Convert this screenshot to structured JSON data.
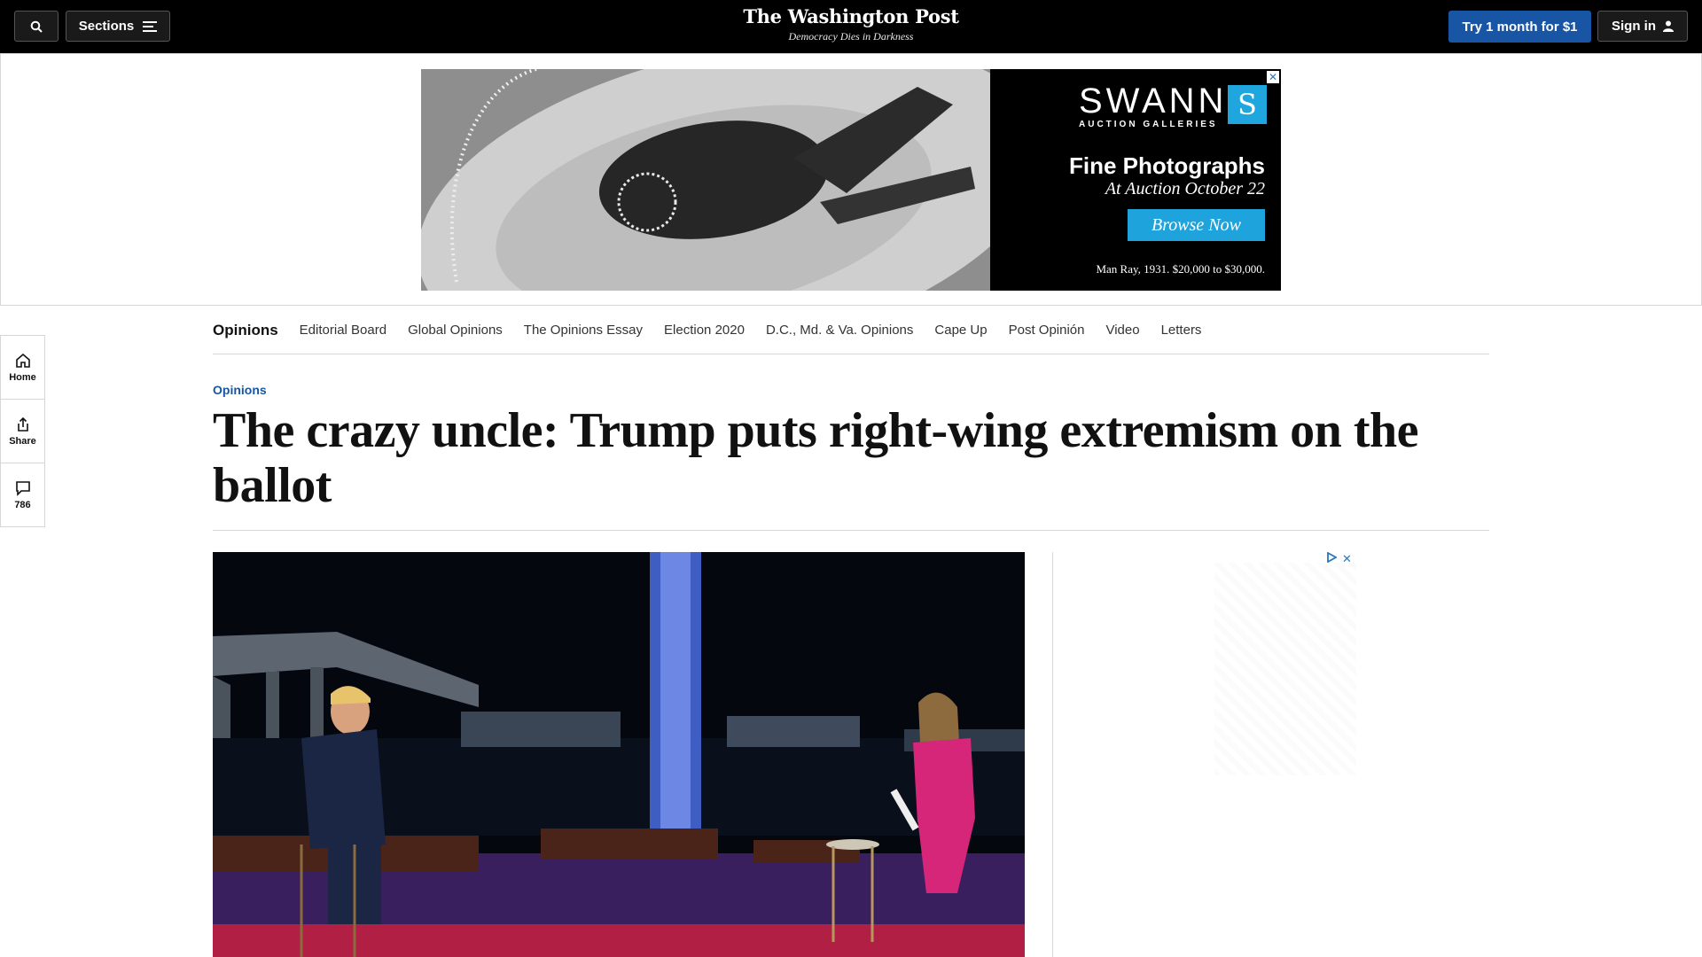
{
  "topbar": {
    "sections_label": "Sections",
    "brand": "The Washington Post",
    "tagline": "Democracy Dies in Darkness",
    "subscribe_label": "Try 1 month for $1",
    "signin_label": "Sign in"
  },
  "ad_banner": {
    "brand": "SWANN",
    "brand_sub": "AUCTION GALLERIES",
    "headline": "Fine Photographs",
    "subline": "At Auction October 22",
    "cta": "Browse Now",
    "caption": "Man Ray, 1931. $20,000 to $30,000.",
    "close": "✕",
    "mark_letter": "S"
  },
  "rail": {
    "home": "Home",
    "share": "Share",
    "comments": "786"
  },
  "section_nav": [
    "Opinions",
    "Editorial Board",
    "Global Opinions",
    "The Opinions Essay",
    "Election 2020",
    "D.C., Md. & Va. Opinions",
    "Cape Up",
    "Post Opinión",
    "Video",
    "Letters"
  ],
  "article": {
    "kicker": "Opinions",
    "headline": "The crazy uncle: Trump puts right-wing extremism on the ballot"
  },
  "side_ad": {
    "close": "✕"
  },
  "colors": {
    "topbar_bg": "#000000",
    "accent_blue": "#1955a5",
    "ad_cta": "#1ea3dd"
  },
  "icons": [
    "search-icon",
    "menu-icon",
    "person-icon",
    "home-icon",
    "share-icon",
    "comment-icon",
    "adchoices-icon",
    "close-icon"
  ]
}
